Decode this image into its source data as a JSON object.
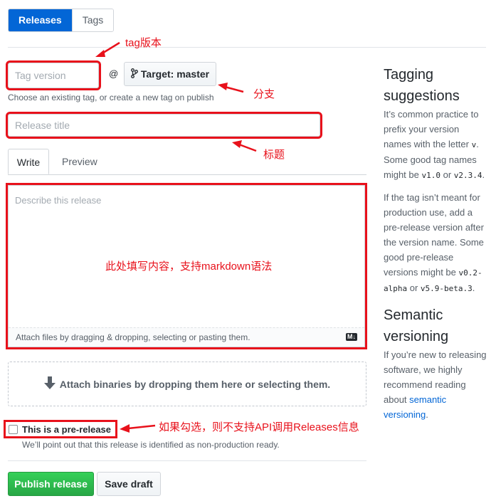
{
  "tabs": {
    "releases": "Releases",
    "tags": "Tags"
  },
  "form": {
    "tag_placeholder": "Tag version",
    "at": "@",
    "target_label": "Target: master",
    "tag_hint": "Choose an existing tag, or create a new tag on publish",
    "title_placeholder": "Release title",
    "write_tab": "Write",
    "preview_tab": "Preview",
    "describe_placeholder": "Describe this release",
    "attach_files": "Attach files by dragging & dropping, selecting or pasting them.",
    "markdown_badge": "M↓",
    "attach_binaries": "Attach binaries by dropping them here or selecting them.",
    "prerelease_label": "This is a pre-release",
    "prerelease_hint": "We’ll point out that this release is identified as non-production ready.",
    "publish_button": "Publish release",
    "draft_button": "Save draft"
  },
  "annotations": {
    "tag": "tag版本",
    "branch": "分支",
    "title": "标题",
    "content": "此处填写内容，支持markdown语法",
    "prerelease": "如果勾选，则不支持API调用Releases信息"
  },
  "sidebar": {
    "tagging_title": "Tagging suggestions",
    "p1_a": "It’s common practice to prefix your version names with the letter ",
    "p1_v": "v",
    "p1_b": ". Some good tag names might be ",
    "p1_c1": "v1.0",
    "p1_or": " or ",
    "p1_c2": "v2.3.4",
    "p1_end": ".",
    "p2_a": "If the tag isn’t meant for production use, add a pre-release version after the version name. Some good pre-release versions might be ",
    "p2_c1": "v0.2-alpha",
    "p2_or": " or ",
    "p2_c2": "v5.9-beta.3",
    "p2_end": ".",
    "semantic_title": "Semantic versioning",
    "p3_a": "If you’re new to releasing software, we highly recommend reading about ",
    "p3_link": "semantic versioning",
    "p3_end": "."
  }
}
